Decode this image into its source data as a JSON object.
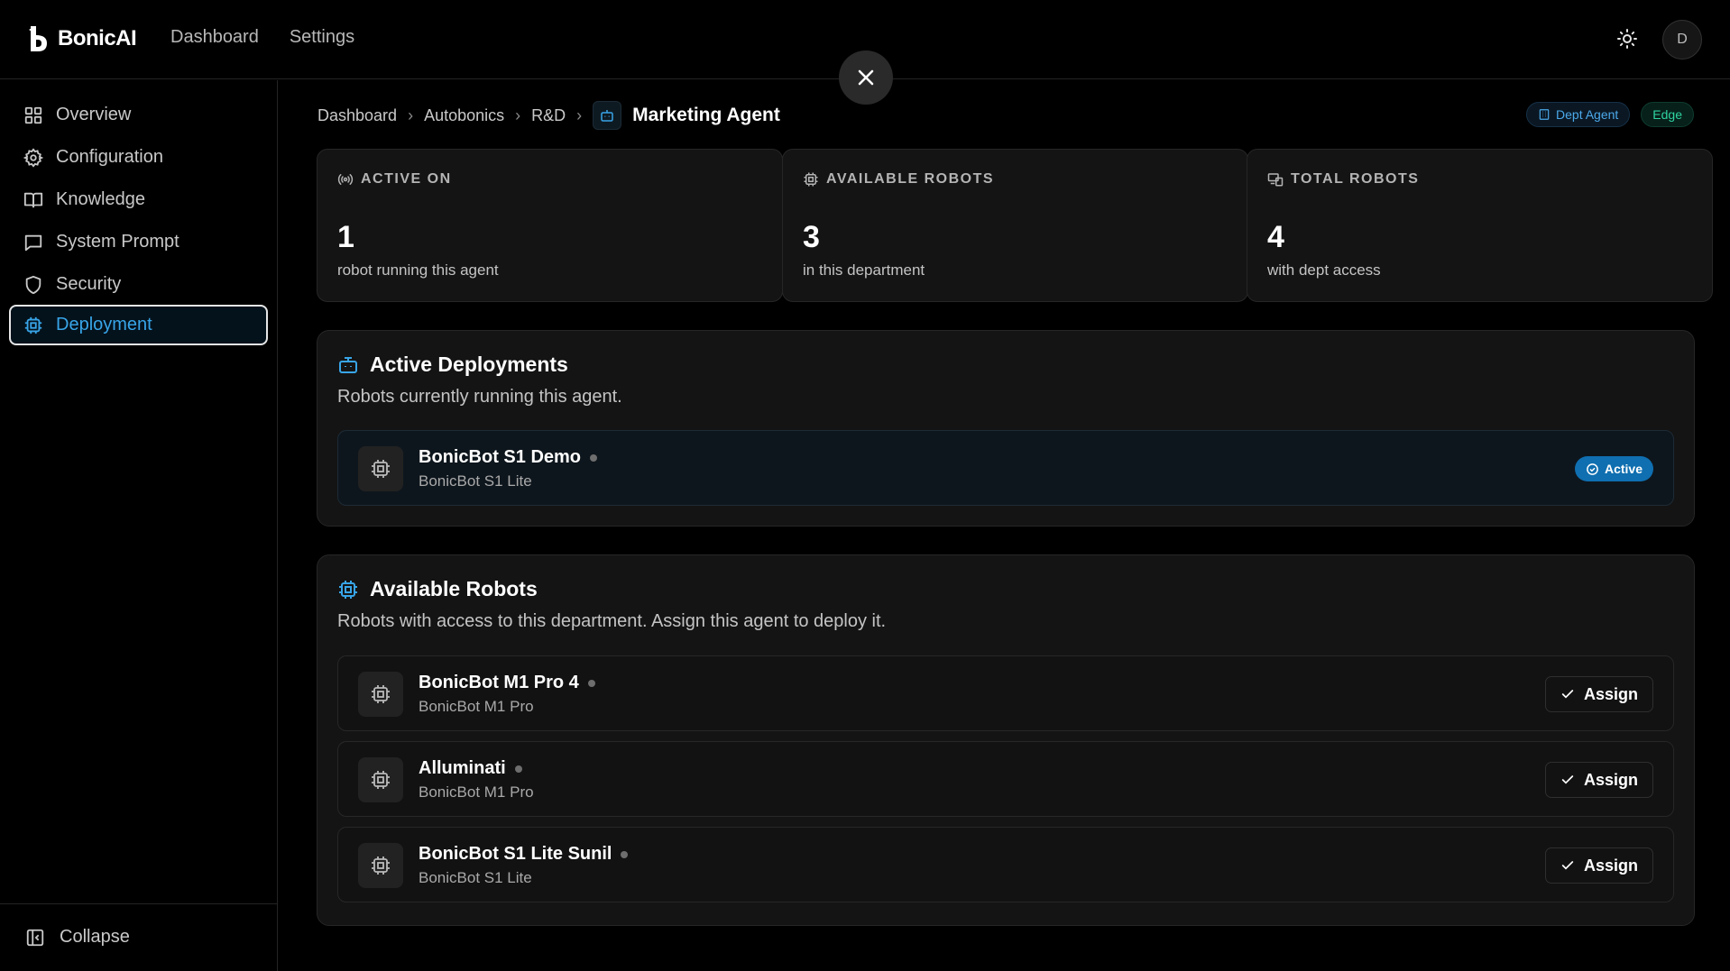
{
  "app": {
    "brand": "BonicAI"
  },
  "topnav": [
    "Dashboard",
    "Settings"
  ],
  "user": {
    "initial": "D"
  },
  "sidebar": {
    "items": [
      {
        "label": "Overview",
        "icon": "grid-icon"
      },
      {
        "label": "Configuration",
        "icon": "gear-icon"
      },
      {
        "label": "Knowledge",
        "icon": "book-icon"
      },
      {
        "label": "System Prompt",
        "icon": "message-icon"
      },
      {
        "label": "Security",
        "icon": "shield-icon"
      },
      {
        "label": "Deployment",
        "icon": "chip-icon",
        "active": true
      }
    ],
    "collapse_label": "Collapse"
  },
  "breadcrumb": {
    "items": [
      "Dashboard",
      "Autobonics",
      "R&D"
    ],
    "current": "Marketing Agent"
  },
  "badges": {
    "dept": "Dept Agent",
    "edge": "Edge"
  },
  "stats": [
    {
      "label": "ACTIVE ON",
      "value": "1",
      "sub": "robot running this agent",
      "icon": "broadcast-icon"
    },
    {
      "label": "AVAILABLE ROBOTS",
      "value": "3",
      "sub": "in this department",
      "icon": "chip-icon"
    },
    {
      "label": "TOTAL ROBOTS",
      "value": "4",
      "sub": "with dept access",
      "icon": "devices-icon"
    }
  ],
  "active_deployments": {
    "title": "Active Deployments",
    "description": "Robots currently running this agent.",
    "robots": [
      {
        "name": "BonicBot S1 Demo",
        "model": "BonicBot S1 Lite",
        "status": "Active"
      }
    ]
  },
  "available_robots": {
    "title": "Available Robots",
    "description": "Robots with access to this department. Assign this agent to deploy it.",
    "assign_label": "Assign",
    "robots": [
      {
        "name": "BonicBot M1 Pro 4",
        "model": "BonicBot M1 Pro"
      },
      {
        "name": "Alluminati",
        "model": "BonicBot M1 Pro"
      },
      {
        "name": "BonicBot S1 Lite Sunil",
        "model": "BonicBot S1 Lite"
      }
    ]
  },
  "colors": {
    "accent": "#38a5e8",
    "edge": "#2fd3a0",
    "background": "#000000",
    "card": "#141414"
  }
}
